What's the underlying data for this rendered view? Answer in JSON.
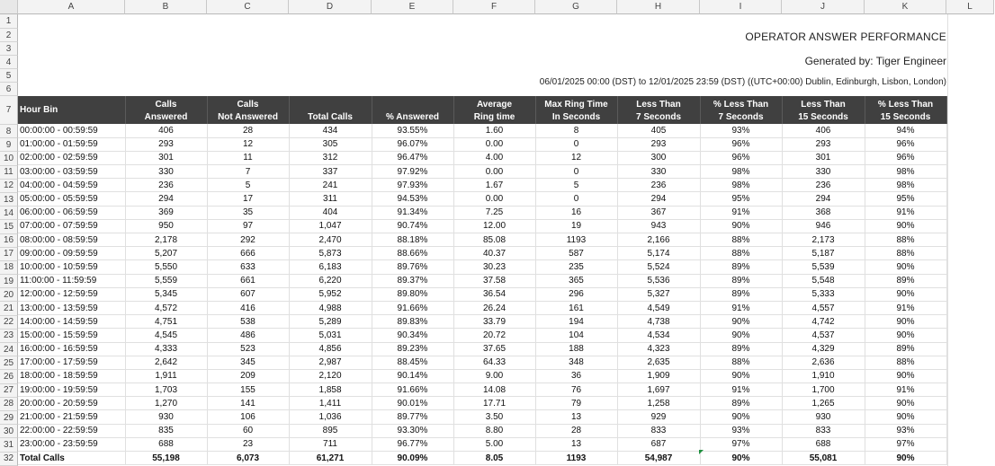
{
  "columns": [
    "A",
    "B",
    "C",
    "D",
    "E",
    "F",
    "G",
    "H",
    "I",
    "J",
    "K",
    "L"
  ],
  "rows": [
    "1",
    "2",
    "3",
    "4",
    "5",
    "6",
    "7",
    "8",
    "9",
    "10",
    "11",
    "12",
    "13",
    "14",
    "15",
    "16",
    "17",
    "18",
    "19",
    "20",
    "21",
    "22",
    "23",
    "24",
    "25",
    "26",
    "27",
    "28",
    "29",
    "30",
    "31",
    "32"
  ],
  "report": {
    "title": "OPERATOR ANSWER PERFORMANCE",
    "generated_by": "Generated by: Tiger Engineer",
    "date_range": "06/01/2025 00:00 (DST) to 12/01/2025 23:59 (DST) ((UTC+00:00) Dublin, Edinburgh, Lisbon, London)"
  },
  "headers": [
    [
      "Hour Bin"
    ],
    [
      "Calls",
      "Answered"
    ],
    [
      "Calls",
      "Not Answered"
    ],
    [
      "Total Calls"
    ],
    [
      "% Answered"
    ],
    [
      "Average",
      "Ring time"
    ],
    [
      "Max Ring Time",
      "In Seconds"
    ],
    [
      "Less Than",
      "7 Seconds"
    ],
    [
      "% Less Than",
      "7 Seconds"
    ],
    [
      "Less Than",
      "15 Seconds"
    ],
    [
      "% Less Than",
      "15 Seconds"
    ]
  ],
  "data_rows": [
    [
      "00:00:00 - 00:59:59",
      "406",
      "28",
      "434",
      "93.55%",
      "1.60",
      "8",
      "405",
      "93%",
      "406",
      "94%"
    ],
    [
      "01:00:00 - 01:59:59",
      "293",
      "12",
      "305",
      "96.07%",
      "0.00",
      "0",
      "293",
      "96%",
      "293",
      "96%"
    ],
    [
      "02:00:00 - 02:59:59",
      "301",
      "11",
      "312",
      "96.47%",
      "4.00",
      "12",
      "300",
      "96%",
      "301",
      "96%"
    ],
    [
      "03:00:00 - 03:59:59",
      "330",
      "7",
      "337",
      "97.92%",
      "0.00",
      "0",
      "330",
      "98%",
      "330",
      "98%"
    ],
    [
      "04:00:00 - 04:59:59",
      "236",
      "5",
      "241",
      "97.93%",
      "1.67",
      "5",
      "236",
      "98%",
      "236",
      "98%"
    ],
    [
      "05:00:00 - 05:59:59",
      "294",
      "17",
      "311",
      "94.53%",
      "0.00",
      "0",
      "294",
      "95%",
      "294",
      "95%"
    ],
    [
      "06:00:00 - 06:59:59",
      "369",
      "35",
      "404",
      "91.34%",
      "7.25",
      "16",
      "367",
      "91%",
      "368",
      "91%"
    ],
    [
      "07:00:00 - 07:59:59",
      "950",
      "97",
      "1,047",
      "90.74%",
      "12.00",
      "19",
      "943",
      "90%",
      "946",
      "90%"
    ],
    [
      "08:00:00 - 08:59:59",
      "2,178",
      "292",
      "2,470",
      "88.18%",
      "85.08",
      "1193",
      "2,166",
      "88%",
      "2,173",
      "88%"
    ],
    [
      "09:00:00 - 09:59:59",
      "5,207",
      "666",
      "5,873",
      "88.66%",
      "40.37",
      "587",
      "5,174",
      "88%",
      "5,187",
      "88%"
    ],
    [
      "10:00:00 - 10:59:59",
      "5,550",
      "633",
      "6,183",
      "89.76%",
      "30.23",
      "235",
      "5,524",
      "89%",
      "5,539",
      "90%"
    ],
    [
      "11:00:00 - 11:59:59",
      "5,559",
      "661",
      "6,220",
      "89.37%",
      "37.58",
      "365",
      "5,536",
      "89%",
      "5,548",
      "89%"
    ],
    [
      "12:00:00 - 12:59:59",
      "5,345",
      "607",
      "5,952",
      "89.80%",
      "36.54",
      "296",
      "5,327",
      "89%",
      "5,333",
      "90%"
    ],
    [
      "13:00:00 - 13:59:59",
      "4,572",
      "416",
      "4,988",
      "91.66%",
      "26.24",
      "161",
      "4,549",
      "91%",
      "4,557",
      "91%"
    ],
    [
      "14:00:00 - 14:59:59",
      "4,751",
      "538",
      "5,289",
      "89.83%",
      "33.79",
      "194",
      "4,738",
      "90%",
      "4,742",
      "90%"
    ],
    [
      "15:00:00 - 15:59:59",
      "4,545",
      "486",
      "5,031",
      "90.34%",
      "20.72",
      "104",
      "4,534",
      "90%",
      "4,537",
      "90%"
    ],
    [
      "16:00:00 - 16:59:59",
      "4,333",
      "523",
      "4,856",
      "89.23%",
      "37.65",
      "188",
      "4,323",
      "89%",
      "4,329",
      "89%"
    ],
    [
      "17:00:00 - 17:59:59",
      "2,642",
      "345",
      "2,987",
      "88.45%",
      "64.33",
      "348",
      "2,635",
      "88%",
      "2,636",
      "88%"
    ],
    [
      "18:00:00 - 18:59:59",
      "1,911",
      "209",
      "2,120",
      "90.14%",
      "9.00",
      "36",
      "1,909",
      "90%",
      "1,910",
      "90%"
    ],
    [
      "19:00:00 - 19:59:59",
      "1,703",
      "155",
      "1,858",
      "91.66%",
      "14.08",
      "76",
      "1,697",
      "91%",
      "1,700",
      "91%"
    ],
    [
      "20:00:00 - 20:59:59",
      "1,270",
      "141",
      "1,411",
      "90.01%",
      "17.71",
      "79",
      "1,258",
      "89%",
      "1,265",
      "90%"
    ],
    [
      "21:00:00 - 21:59:59",
      "930",
      "106",
      "1,036",
      "89.77%",
      "3.50",
      "13",
      "929",
      "90%",
      "930",
      "90%"
    ],
    [
      "22:00:00 - 22:59:59",
      "835",
      "60",
      "895",
      "93.30%",
      "8.80",
      "28",
      "833",
      "93%",
      "833",
      "93%"
    ],
    [
      "23:00:00 - 23:59:59",
      "688",
      "23",
      "711",
      "96.77%",
      "5.00",
      "13",
      "687",
      "97%",
      "688",
      "97%"
    ]
  ],
  "total_row": [
    "Total Calls",
    "55,198",
    "6,073",
    "61,271",
    "90.09%",
    "8.05",
    "1193",
    "54,987",
    "90%",
    "55,081",
    "90%"
  ],
  "colors": {
    "header_bg": "#404040",
    "header_text": "#ffffff",
    "gridline": "#e0e0e0",
    "error_indicator": "#1e8f3e"
  }
}
